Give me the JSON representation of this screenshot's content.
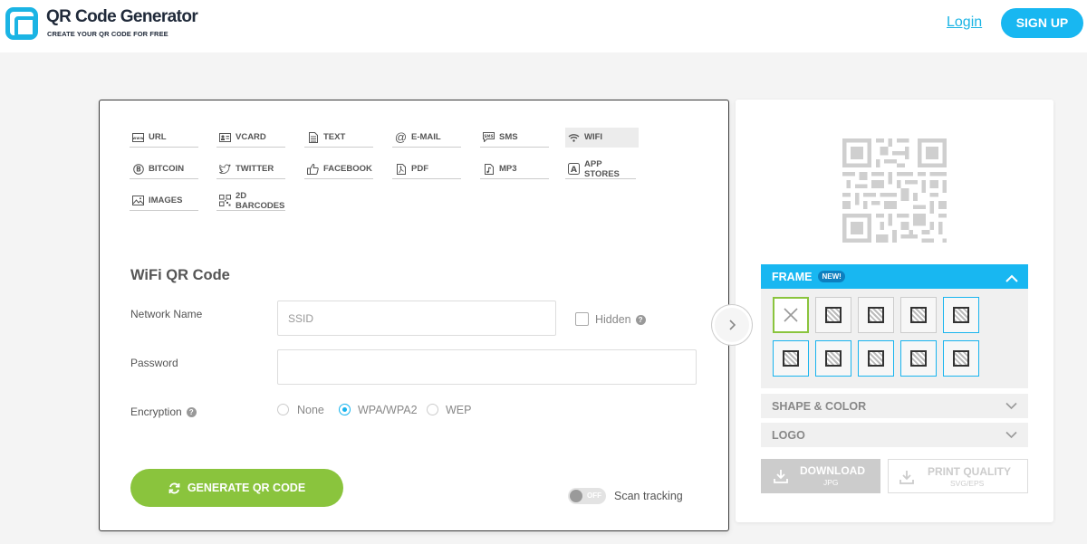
{
  "header": {
    "brand_title": "QR Code Generator",
    "brand_subtitle": "CREATE YOUR QR CODE FOR FREE",
    "login_label": "Login",
    "signup_label": "SIGN UP",
    "accent_color": "#1bb4e4"
  },
  "types": [
    {
      "label": "URL",
      "icon": "url-icon"
    },
    {
      "label": "VCARD",
      "icon": "vcard-icon"
    },
    {
      "label": "TEXT",
      "icon": "text-icon"
    },
    {
      "label": "E-MAIL",
      "icon": "at-icon"
    },
    {
      "label": "SMS",
      "icon": "sms-icon"
    },
    {
      "label": "WIFI",
      "icon": "wifi-icon",
      "active": true
    },
    {
      "label": "BITCOIN",
      "icon": "bitcoin-icon"
    },
    {
      "label": "TWITTER",
      "icon": "twitter-icon"
    },
    {
      "label": "FACEBOOK",
      "icon": "thumbs-up-icon"
    },
    {
      "label": "PDF",
      "icon": "pdf-icon"
    },
    {
      "label": "MP3",
      "icon": "music-note-icon"
    },
    {
      "label": "APP STORES",
      "icon": "app-store-icon"
    },
    {
      "label": "IMAGES",
      "icon": "image-icon"
    },
    {
      "label": "2D BARCODES",
      "icon": "barcode-icon"
    }
  ],
  "form": {
    "title": "WiFi QR Code",
    "network_label": "Network Name",
    "ssid_placeholder": "SSID",
    "hidden_label": "Hidden",
    "password_label": "Password",
    "password_value": "",
    "encryption_label": "Encryption",
    "encryption_options": [
      "None",
      "WPA/WPA2",
      "WEP"
    ],
    "encryption_selected": "WPA/WPA2",
    "generate_label": "GENERATE QR CODE",
    "toggle_text": "OFF",
    "scan_tracking_label": "Scan tracking"
  },
  "panel": {
    "frame_label": "FRAME",
    "frame_badge": "NEW!",
    "shape_color_label": "SHAPE & COLOR",
    "logo_label": "LOGO",
    "download_label": "DOWNLOAD",
    "download_format": "JPG",
    "print_label": "PRINT QUALITY",
    "print_format": "SVG/EPS"
  }
}
